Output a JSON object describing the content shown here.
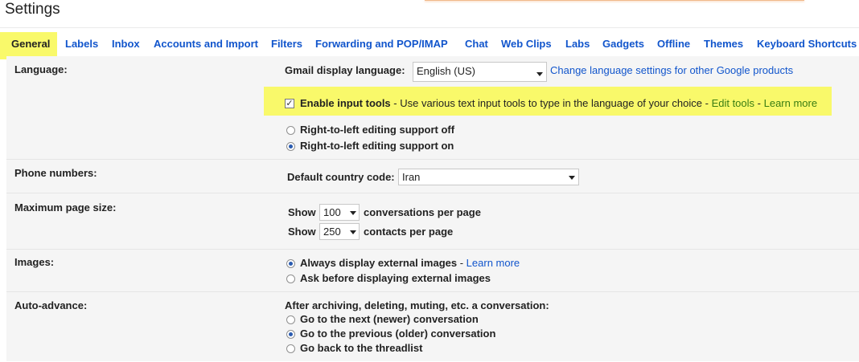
{
  "header": {
    "title": "Settings"
  },
  "tabs": [
    {
      "label": "General",
      "active": true
    },
    {
      "label": "Labels"
    },
    {
      "label": "Inbox"
    },
    {
      "label": "Accounts and Import"
    },
    {
      "label": "Filters"
    },
    {
      "label": "Forwarding and POP/IMAP"
    },
    {
      "label": "Chat"
    },
    {
      "label": "Web Clips"
    },
    {
      "label": "Labs"
    },
    {
      "label": "Gadgets"
    },
    {
      "label": "Offline"
    },
    {
      "label": "Themes"
    },
    {
      "label": "Keyboard Shortcuts"
    }
  ],
  "language": {
    "label": "Language:",
    "display_label": "Gmail display language:",
    "display_value": "English (US)",
    "change_link": "Change language settings for other Google products",
    "input_tools_label": "Enable input tools",
    "input_tools_checked": true,
    "input_tools_desc": " - Use various text input tools to type in the language of your choice - ",
    "edit_tools": "Edit tools",
    "sep": " - ",
    "learn_more": "Learn more",
    "rtl_off": "Right-to-left editing support off",
    "rtl_on": "Right-to-left editing support on",
    "rtl_selected": "on"
  },
  "phone": {
    "label": "Phone numbers:",
    "country_label": "Default country code:",
    "country_value": "Iran"
  },
  "page_size": {
    "label": "Maximum page size:",
    "show1": "Show",
    "conv_value": "100",
    "conv_suffix": "conversations per page",
    "show2": "Show",
    "contacts_value": "250",
    "contacts_suffix": "contacts per page"
  },
  "images": {
    "label": "Images:",
    "always": "Always display external images",
    "sep": " - ",
    "learn_more": "Learn more",
    "ask": "Ask before displaying external images",
    "selected": "always"
  },
  "auto_advance": {
    "label": "Auto-advance:",
    "intro": "After archiving, deleting, muting, etc. a conversation:",
    "next": "Go to the next (newer) conversation",
    "previous": "Go to the previous (older) conversation",
    "threadlist": "Go back to the threadlist",
    "selected": "previous"
  },
  "colors": {
    "link": "#1155cc",
    "highlight": "#f9f96a",
    "green_link": "#3a7d12"
  }
}
